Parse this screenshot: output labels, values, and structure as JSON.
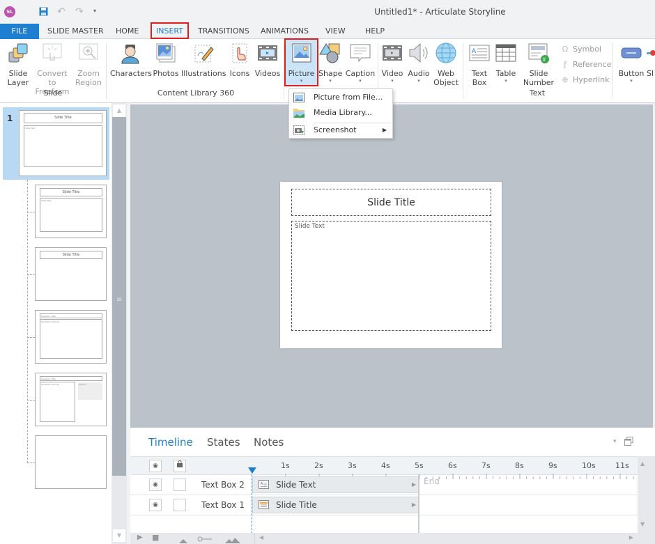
{
  "app": {
    "badge": "SL",
    "title": "Untitled1* -  Articulate Storyline"
  },
  "quick_access": {
    "save": "save-icon",
    "undo": "↶",
    "redo": "↷",
    "more": "▾"
  },
  "menu_tabs": [
    {
      "label": "FILE"
    },
    {
      "label": "SLIDE MASTER"
    },
    {
      "label": "HOME"
    },
    {
      "label": "INSERT",
      "active": true
    },
    {
      "label": "TRANSITIONS"
    },
    {
      "label": "ANIMATIONS"
    },
    {
      "label": "VIEW"
    },
    {
      "label": "HELP"
    }
  ],
  "ribbon": {
    "groups": {
      "slide": "Slide",
      "content_library": "Content Library 360",
      "text": "Text"
    },
    "buttons": {
      "slide_layer": [
        "Slide",
        "Layer"
      ],
      "convert_freeform": [
        "Convert to",
        "Freeform"
      ],
      "zoom_region": [
        "Zoom",
        "Region"
      ],
      "characters": "Characters",
      "photos": "Photos",
      "illustrations": "Illustrations",
      "icons": "Icons",
      "videos": "Videos",
      "picture": "Picture",
      "shape": "Shape",
      "caption": "Caption",
      "video": "Video",
      "audio": "Audio",
      "web_object": [
        "Web",
        "Object"
      ],
      "text_box": [
        "Text",
        "Box"
      ],
      "table": "Table",
      "slide_number": [
        "Slide",
        "Number"
      ],
      "symbol": "Symbol",
      "reference": "Reference",
      "hyperlink": "Hyperlink",
      "button": "Button",
      "slider": "Sl"
    },
    "caret": "▾"
  },
  "picture_dropdown": {
    "items": [
      {
        "label": "Picture from File...",
        "icon": "picture-file-icon"
      },
      {
        "label": "Media Library...",
        "icon": "media-library-icon"
      },
      {
        "label": "Screenshot",
        "icon": "screenshot-icon",
        "submenu": "▶"
      }
    ]
  },
  "slide_panel": {
    "scene_number": "1",
    "thumbs": [
      {
        "title": "Slide Title",
        "body": "Slide Text"
      },
      {
        "title": "Slide Title",
        "body": "Slide Text"
      },
      {
        "title": "Slide Title",
        "body": ""
      },
      {
        "title": "Question Title",
        "body": "Question Choices"
      },
      {
        "title": "Question Title",
        "body": "Question Choices",
        "extra": "Picture"
      },
      {
        "title": "",
        "body": ""
      }
    ],
    "scroll_grip": "≡",
    "scroll_up": "▲",
    "scroll_down": "▼"
  },
  "slide": {
    "title": "Slide Title",
    "text": "Slide Text"
  },
  "timeline": {
    "tabs": [
      "Timeline",
      "States",
      "Notes"
    ],
    "ticks": [
      "1s",
      "2s",
      "3s",
      "4s",
      "5s",
      "6s",
      "7s",
      "8s",
      "9s",
      "10s",
      "11s"
    ],
    "rows": [
      {
        "name": "Text Box 2",
        "bar_label": "Slide Text",
        "icon": "text-box-icon"
      },
      {
        "name": "Text Box 1",
        "bar_label": "Slide Title",
        "icon": "title-box-icon"
      }
    ],
    "end_label": "End",
    "eye": "◉",
    "lock": "🔒",
    "expand": "▾",
    "scroll_up": "▲",
    "scroll_down": "▼",
    "scroll_left": "◀",
    "scroll_right": "▶",
    "play": "▶",
    "stop": "■"
  },
  "colors": {
    "accent": "#1e7fd0",
    "highlight_box": "#e01e1e",
    "selection": "#b7d9f3",
    "canvas_bg": "#bcc2c9"
  }
}
